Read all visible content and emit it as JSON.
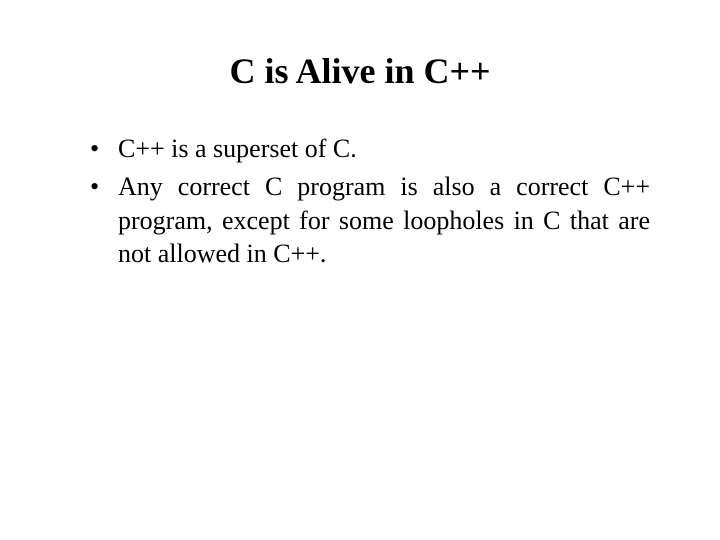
{
  "title": "C is Alive in C++",
  "bullets": [
    "C++ is a superset of C.",
    "Any correct C program is also a correct C++ program, except for some loopholes in C that are not allowed in C++."
  ]
}
